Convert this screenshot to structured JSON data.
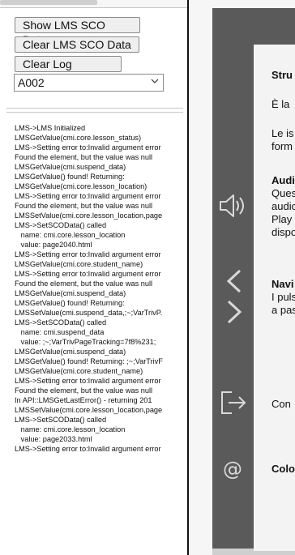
{
  "debug_panel": {
    "buttons": {
      "show_sco": "Show LMS SCO Data",
      "clear_sco": "Clear LMS SCO Data",
      "clear_log": "Clear Log Window"
    },
    "sco_select": {
      "value": "A002"
    },
    "log_lines": [
      "LMS->LMS Initialized",
      "LMSGetValue(cmi.core.lesson_status)",
      "LMS->Setting error to:Invalid argument error",
      "Found the element, but the value was null",
      "LMSGetValue(cmi.suspend_data)",
      "LMSGetValue() found! Returning:",
      "LMSGetValue(cmi.core.lesson_location)",
      "LMS->Setting error to:Invalid argument error",
      "Found the element, but the value was null",
      "LMSSetValue(cmi.core.lesson_location,page",
      "LMS->SetSCOData() called",
      "   name: cmi.core.lesson_location",
      "   value: page2040.html",
      "LMS->Setting error to:Invalid argument error",
      "LMSGetValue(cmi.core.student_name)",
      "LMS->Setting error to:Invalid argument error",
      "Found the element, but the value was null",
      "LMSGetValue(cmi.suspend_data)",
      "LMSGetValue() found! Returning:",
      "LMSSetValue(cmi.suspend_data,;~;VarTrivP.",
      "LMS->SetSCOData() called",
      "   name: cmi.suspend_data",
      "   value: ;~;VarTrivPageTracking=7f8%231;",
      "LMSGetValue(cmi.suspend_data)",
      "LMSGetValue() found! Returning: ;~;VarTrivF",
      "LMSGetValue(cmi.core.student_name)",
      "LMS->Setting error to:Invalid argument error",
      "Found the element, but the value was null",
      "In API::LMSGetLastError() - returning 201",
      "LMSSetValue(cmi.core.lesson_location,page",
      "LMS->SetSCOData() called",
      "   name: cmi.core.lesson_location",
      "   value: page2033.html",
      "LMS->Setting error to:Invalid argument error"
    ]
  },
  "viewer": {
    "icons": [
      "audio-icon",
      "prev-arrow-icon",
      "next-arrow-icon",
      "exit-icon",
      "contact-at-icon"
    ],
    "card_lines": [
      {
        "text": "Stru",
        "bold": true
      },
      {
        "text": "È la",
        "bold": false
      },
      {
        "text": "Le is",
        "bold": false
      },
      {
        "text": "form",
        "bold": false
      },
      {
        "text": "Audi",
        "bold": true
      },
      {
        "text": "Ques",
        "bold": false
      },
      {
        "text": "audio",
        "bold": false
      },
      {
        "text": "Play",
        "bold": false
      },
      {
        "text": "dispo",
        "bold": false
      },
      {
        "text": "Navi",
        "bold": true
      },
      {
        "text": "I puls",
        "bold": false
      },
      {
        "text": "a pas",
        "bold": false
      },
      {
        "text": "Con",
        "bold": false
      },
      {
        "text": "Colo",
        "bold": true
      }
    ]
  },
  "colors": {
    "frame": "#5a5a5a",
    "card": "#f3f3f3",
    "icon": "#d9d9d9"
  }
}
